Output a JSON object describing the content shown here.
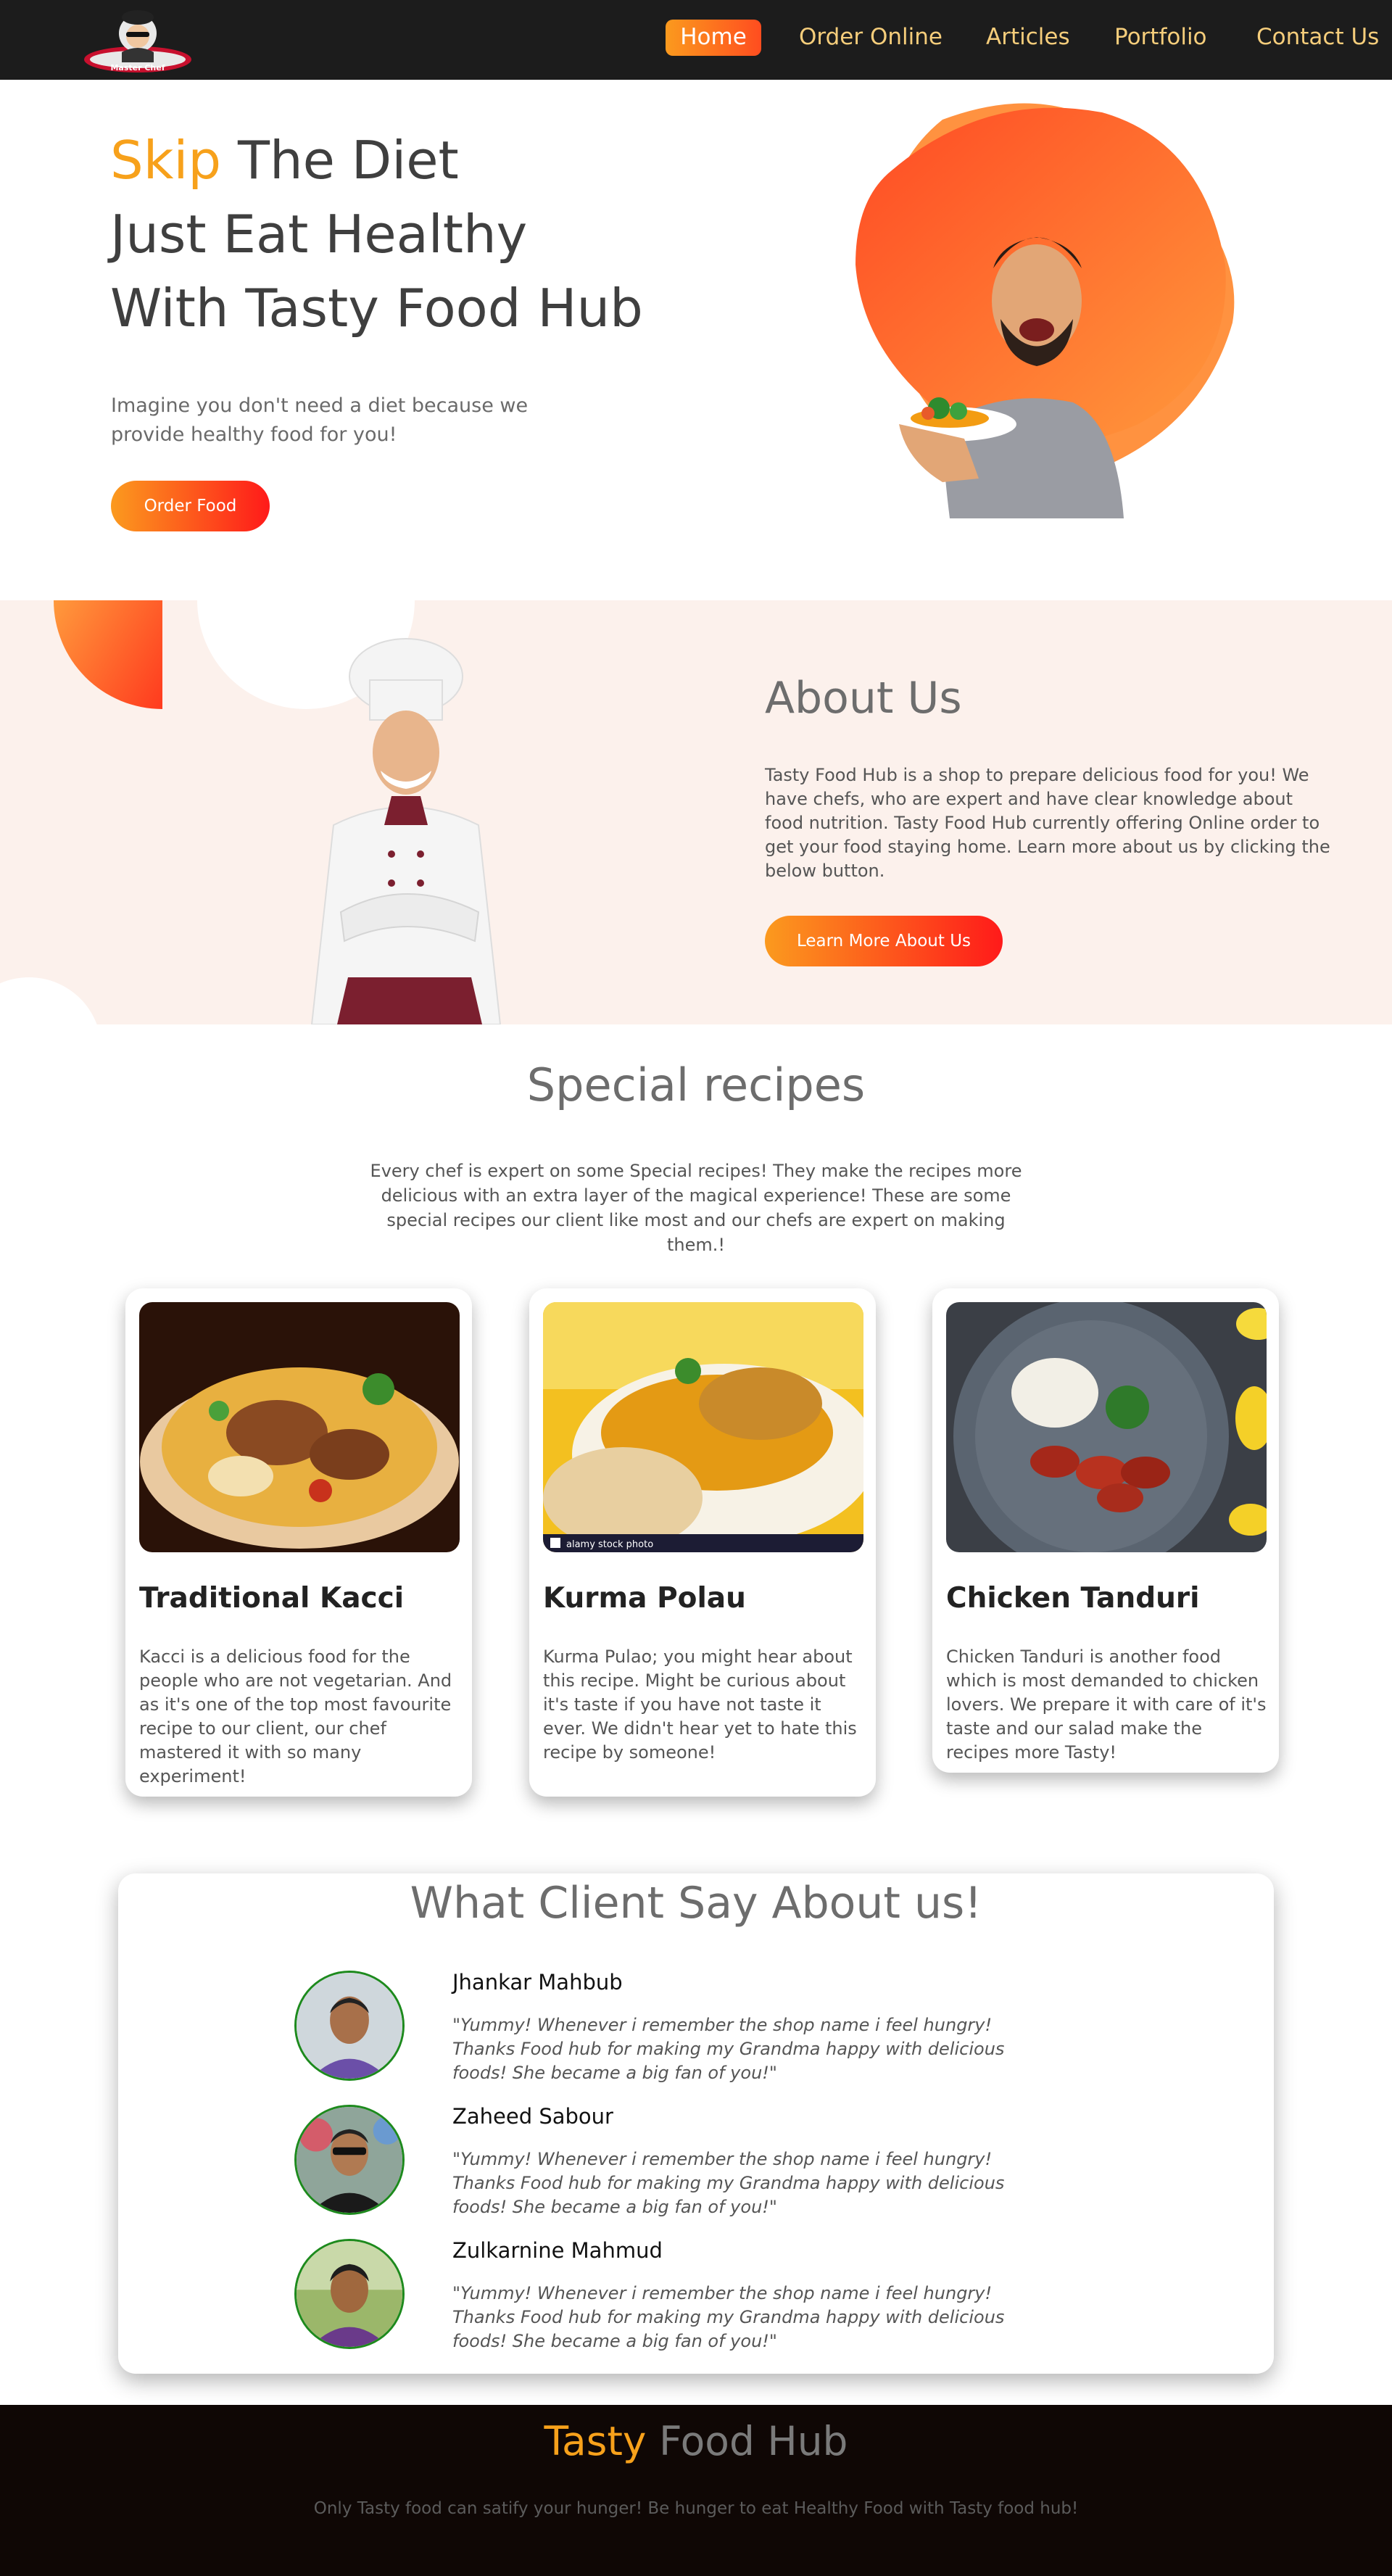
{
  "nav": {
    "logo_text": "Master Chef",
    "items": [
      {
        "label": "Home",
        "active": true
      },
      {
        "label": "Order Online"
      },
      {
        "label": "Articles"
      },
      {
        "label": "Portfolio"
      },
      {
        "label": "Contact Us"
      }
    ]
  },
  "hero": {
    "title_accent": "Skip",
    "title_line1_rest": " The Diet",
    "title_line2": "Just Eat Healthy",
    "title_line3": "With Tasty Food Hub",
    "description": "Imagine you don't need a diet because we provide healthy food for you!",
    "button_label": "Order Food"
  },
  "about": {
    "title": "About Us",
    "description": "Tasty Food Hub is a shop to prepare delicious food for you! We have chefs, who are expert and have clear knowledge about food nutrition. Tasty Food Hub currently offering Online order to get your food staying home. Learn more about us by clicking the below button.",
    "button_label": "Learn More About Us"
  },
  "recipes": {
    "title": "Special recipes",
    "description": "Every chef is expert on some Special recipes! They make the recipes more delicious with an extra layer of the magical experience! These are some special recipes our client like most and our chefs are expert on making them.!",
    "cards": [
      {
        "title": "Traditional Kacci",
        "text": "Kacci is a delicious food for the people who are not vegetarian. And as it's one of the top most favourite recipe to our client, our chef mastered it with so many experiment!"
      },
      {
        "title": "Kurma Polau",
        "text": "Kurma Pulao; you might hear about this recipe. Might be curious about it's taste if you have not taste it ever. We didn't hear yet to hate this recipe by someone!",
        "watermark": "alamy stock photo"
      },
      {
        "title": "Chicken Tanduri",
        "text": "Chicken Tanduri is another food which is most demanded to chicken lovers. We prepare it with care of it's taste and our salad make the recipes more Tasty!"
      }
    ]
  },
  "testimonials": {
    "title": "What Client Say About us!",
    "items": [
      {
        "name": "Jhankar Mahbub",
        "quote": "\"Yummy! Whenever i remember the shop name i feel hungry! Thanks Food hub for making my Grandma happy with delicious foods! She became a big fan of you!\""
      },
      {
        "name": "Zaheed Sabour",
        "quote": "\"Yummy! Whenever i remember the shop name i feel hungry! Thanks Food hub for making my Grandma happy with delicious foods! She became a big fan of you!\""
      },
      {
        "name": "Zulkarnine Mahmud",
        "quote": "\"Yummy! Whenever i remember the shop name i feel hungry! Thanks Food hub for making my Grandma happy with delicious foods! She became a big fan of you!\""
      }
    ]
  },
  "footer": {
    "title_accent": "Tasty",
    "title_rest": " Food Hub",
    "description": "Only Tasty food can satify your hunger! Be hunger to eat Healthy Food with Tasty food hub!"
  },
  "colors": {
    "accent": "#f7a11b",
    "gradient_start": "#fb9a1e",
    "gradient_end": "#ff1a1a",
    "nav_bg": "#1c1c1c",
    "nav_link": "#f5cd7b",
    "about_bg": "#fcf1ec",
    "footer_bg": "#0f0705"
  }
}
